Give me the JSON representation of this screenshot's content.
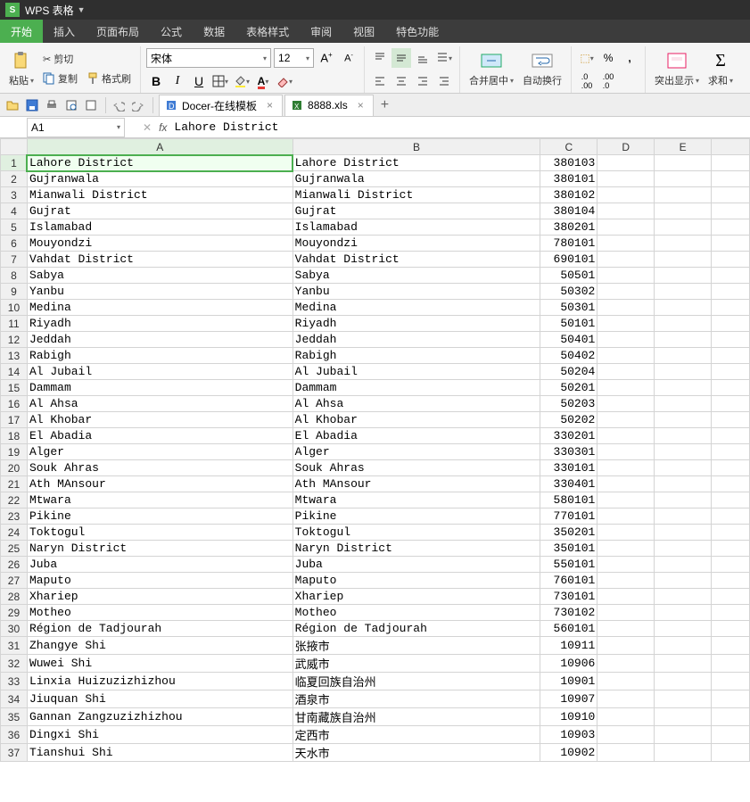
{
  "app": {
    "title": "WPS 表格"
  },
  "menu": {
    "items": [
      "开始",
      "插入",
      "页面布局",
      "公式",
      "数据",
      "表格样式",
      "审阅",
      "视图",
      "特色功能"
    ],
    "active": 0
  },
  "ribbon": {
    "paste": "粘贴",
    "cut": "剪切",
    "copy": "复制",
    "format_painter": "格式刷",
    "font_name": "宋体",
    "font_size": "12",
    "merge_center": "合并居中",
    "wrap_text": "自动换行",
    "highlight": "突出显示",
    "sum": "求和"
  },
  "tabs": {
    "docer": "Docer-在线模板",
    "file": "8888.xls"
  },
  "namebox": "A1",
  "formula": "Lahore District",
  "columns": [
    "A",
    "B",
    "C",
    "D",
    "E",
    ""
  ],
  "rows": [
    {
      "n": 1,
      "a": "Lahore District",
      "b": "Lahore District",
      "c": "380103"
    },
    {
      "n": 2,
      "a": "Gujranwala",
      "b": "Gujranwala",
      "c": "380101"
    },
    {
      "n": 3,
      "a": "Mianwali District",
      "b": "Mianwali District",
      "c": "380102"
    },
    {
      "n": 4,
      "a": "Gujrat",
      "b": "Gujrat",
      "c": "380104"
    },
    {
      "n": 5,
      "a": "Islamabad",
      "b": "Islamabad",
      "c": "380201"
    },
    {
      "n": 6,
      "a": "Mouyondzi",
      "b": "Mouyondzi",
      "c": "780101"
    },
    {
      "n": 7,
      "a": "Vahdat District",
      "b": "Vahdat District",
      "c": "690101"
    },
    {
      "n": 8,
      "a": "Sabya",
      "b": "Sabya",
      "c": "50501"
    },
    {
      "n": 9,
      "a": "Yanbu",
      "b": "Yanbu",
      "c": "50302"
    },
    {
      "n": 10,
      "a": "Medina",
      "b": "Medina",
      "c": "50301"
    },
    {
      "n": 11,
      "a": "Riyadh",
      "b": "Riyadh",
      "c": "50101"
    },
    {
      "n": 12,
      "a": "Jeddah",
      "b": "Jeddah",
      "c": "50401"
    },
    {
      "n": 13,
      "a": "Rabigh",
      "b": "Rabigh",
      "c": "50402"
    },
    {
      "n": 14,
      "a": "Al Jubail",
      "b": "Al Jubail",
      "c": "50204"
    },
    {
      "n": 15,
      "a": "Dammam",
      "b": "Dammam",
      "c": "50201"
    },
    {
      "n": 16,
      "a": "Al Ahsa",
      "b": "Al Ahsa",
      "c": "50203"
    },
    {
      "n": 17,
      "a": "Al Khobar",
      "b": "Al Khobar",
      "c": "50202"
    },
    {
      "n": 18,
      "a": "El Abadia",
      "b": "El Abadia",
      "c": "330201"
    },
    {
      "n": 19,
      "a": "Alger",
      "b": "Alger",
      "c": "330301"
    },
    {
      "n": 20,
      "a": "Souk Ahras",
      "b": "Souk Ahras",
      "c": "330101"
    },
    {
      "n": 21,
      "a": "Ath MAnsour",
      "b": "Ath MAnsour",
      "c": "330401"
    },
    {
      "n": 22,
      "a": "Mtwara",
      "b": "Mtwara",
      "c": "580101"
    },
    {
      "n": 23,
      "a": "Pikine",
      "b": "Pikine",
      "c": "770101"
    },
    {
      "n": 24,
      "a": "Toktogul",
      "b": "Toktogul",
      "c": "350201"
    },
    {
      "n": 25,
      "a": "Naryn District",
      "b": "Naryn District",
      "c": "350101"
    },
    {
      "n": 26,
      "a": "Juba",
      "b": "Juba",
      "c": "550101"
    },
    {
      "n": 27,
      "a": "Maputo",
      "b": "Maputo",
      "c": "760101"
    },
    {
      "n": 28,
      "a": "Xhariep",
      "b": "Xhariep",
      "c": "730101"
    },
    {
      "n": 29,
      "a": "Motheo",
      "b": "Motheo",
      "c": "730102"
    },
    {
      "n": 30,
      "a": "Région de Tadjourah",
      "b": "Région de Tadjourah",
      "c": "560101"
    },
    {
      "n": 31,
      "a": "Zhangye Shi",
      "b": "张掖市",
      "c": "10911"
    },
    {
      "n": 32,
      "a": "Wuwei Shi",
      "b": "武威市",
      "c": "10906"
    },
    {
      "n": 33,
      "a": "Linxia Huizuzizhizhou",
      "b": "临夏回族自治州",
      "c": "10901"
    },
    {
      "n": 34,
      "a": "Jiuquan Shi",
      "b": "酒泉市",
      "c": "10907"
    },
    {
      "n": 35,
      "a": "Gannan Zangzuzizhizhou",
      "b": "甘南藏族自治州",
      "c": "10910"
    },
    {
      "n": 36,
      "a": "Dingxi Shi",
      "b": "定西市",
      "c": "10903"
    },
    {
      "n": 37,
      "a": "Tianshui Shi",
      "b": "天水市",
      "c": "10902"
    }
  ]
}
